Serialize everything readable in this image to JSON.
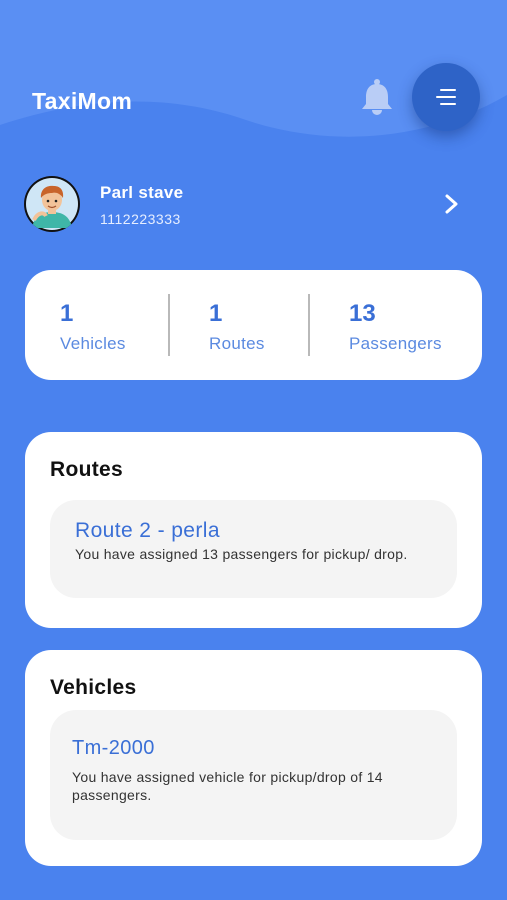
{
  "app": {
    "title": "TaxiMom"
  },
  "colors": {
    "background": "#4a82ee",
    "accent": "#3a6fd6",
    "menu_button": "#2e63c7",
    "card": "#ffffff",
    "item": "#f4f4f4"
  },
  "icons": {
    "notification": "bell-icon",
    "menu": "menu-icon",
    "avatar": "user-avatar",
    "navigate": "chevron-right-icon"
  },
  "user": {
    "name": "Parl stave",
    "phone": "1112223333"
  },
  "stats": [
    {
      "value": "1",
      "label": "Vehicles"
    },
    {
      "value": "1",
      "label": "Routes"
    },
    {
      "value": "13",
      "label": "Passengers"
    }
  ],
  "routes": {
    "title": "Routes",
    "items": [
      {
        "name": "Route 2 - perla",
        "description": "You have assigned 13 passengers for pickup/ drop."
      }
    ]
  },
  "vehicles": {
    "title": "Vehicles",
    "items": [
      {
        "name": "Tm-2000",
        "description": "You have assigned vehicle for pickup/drop of 14 passengers."
      }
    ]
  }
}
